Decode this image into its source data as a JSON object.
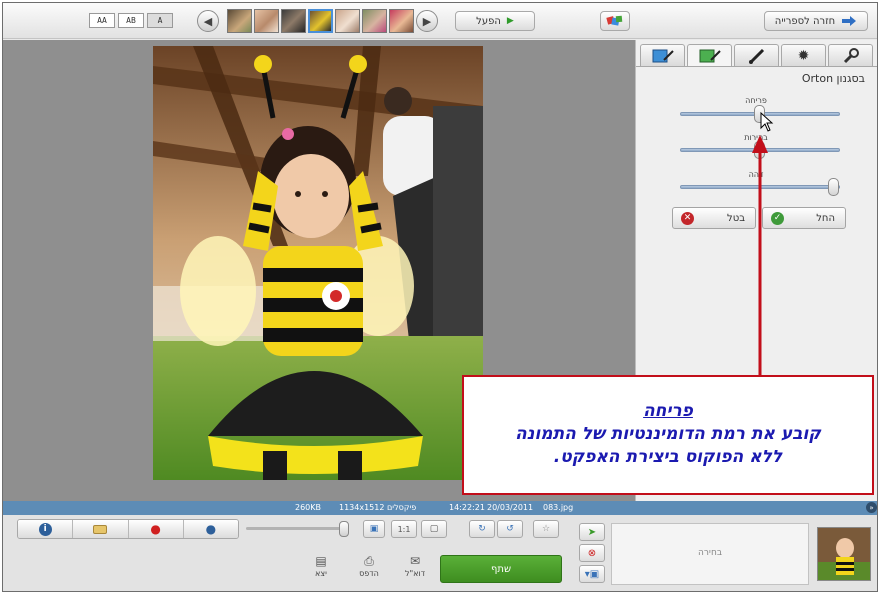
{
  "toolbar": {
    "back_to_library_label": "חזרה לספרייה",
    "play_label": "הפעל",
    "play_icon": "play-icon",
    "text_size_buttons": [
      "AA",
      "AB",
      "A"
    ],
    "nav_prev_icon": "arrow-left-icon",
    "nav_next_icon": "arrow-right-icon",
    "thumbnail_count": 7,
    "selected_thumbnail": 4
  },
  "edit_panel": {
    "tabs": [
      {
        "icon": "fix-brush-icon"
      },
      {
        "icon": "tuning-brush-icon"
      },
      {
        "icon": "paint-brush-icon"
      },
      {
        "icon": "effects-sparkle-icon"
      },
      {
        "icon": "wrench-icon"
      }
    ],
    "active_tab": 1,
    "title": "בסגנון Orton",
    "sliders": [
      {
        "label": "פריחה",
        "value": 0.5
      },
      {
        "label": "בהירות",
        "value": 0.5
      },
      {
        "label": "דהה",
        "value": 1.0
      }
    ],
    "apply_label": "החל",
    "cancel_label": "בטל"
  },
  "info_bar": {
    "filename": "083.jpg",
    "date": "20/03/2011",
    "time": "14:22:21",
    "dimensions": "1134x1512 פיקסלים",
    "size": "260KB"
  },
  "bottom": {
    "info_icons": [
      "info-icon",
      "tag-icon",
      "location-pin-icon",
      "person-icon"
    ],
    "zoom_value": 1.0,
    "share_label": "שתף",
    "actions": [
      {
        "label": "דוא\"ל",
        "icon": "envelope-icon"
      },
      {
        "label": "הדפס",
        "icon": "printer-icon"
      },
      {
        "label": "יצא",
        "icon": "export-folder-icon"
      }
    ],
    "selection_label": "בחירה"
  },
  "callout": {
    "title": "פריחה",
    "line1": "קובע את רמת הדומיננטיות של התמונה",
    "line2": "ללא הפוקוס ביצירת האפקט."
  },
  "colors": {
    "callout_border": "#c20e1a",
    "callout_text": "#1b1ab0",
    "info_bar": "#5d8cb6",
    "share_button": "#3e8d20"
  }
}
